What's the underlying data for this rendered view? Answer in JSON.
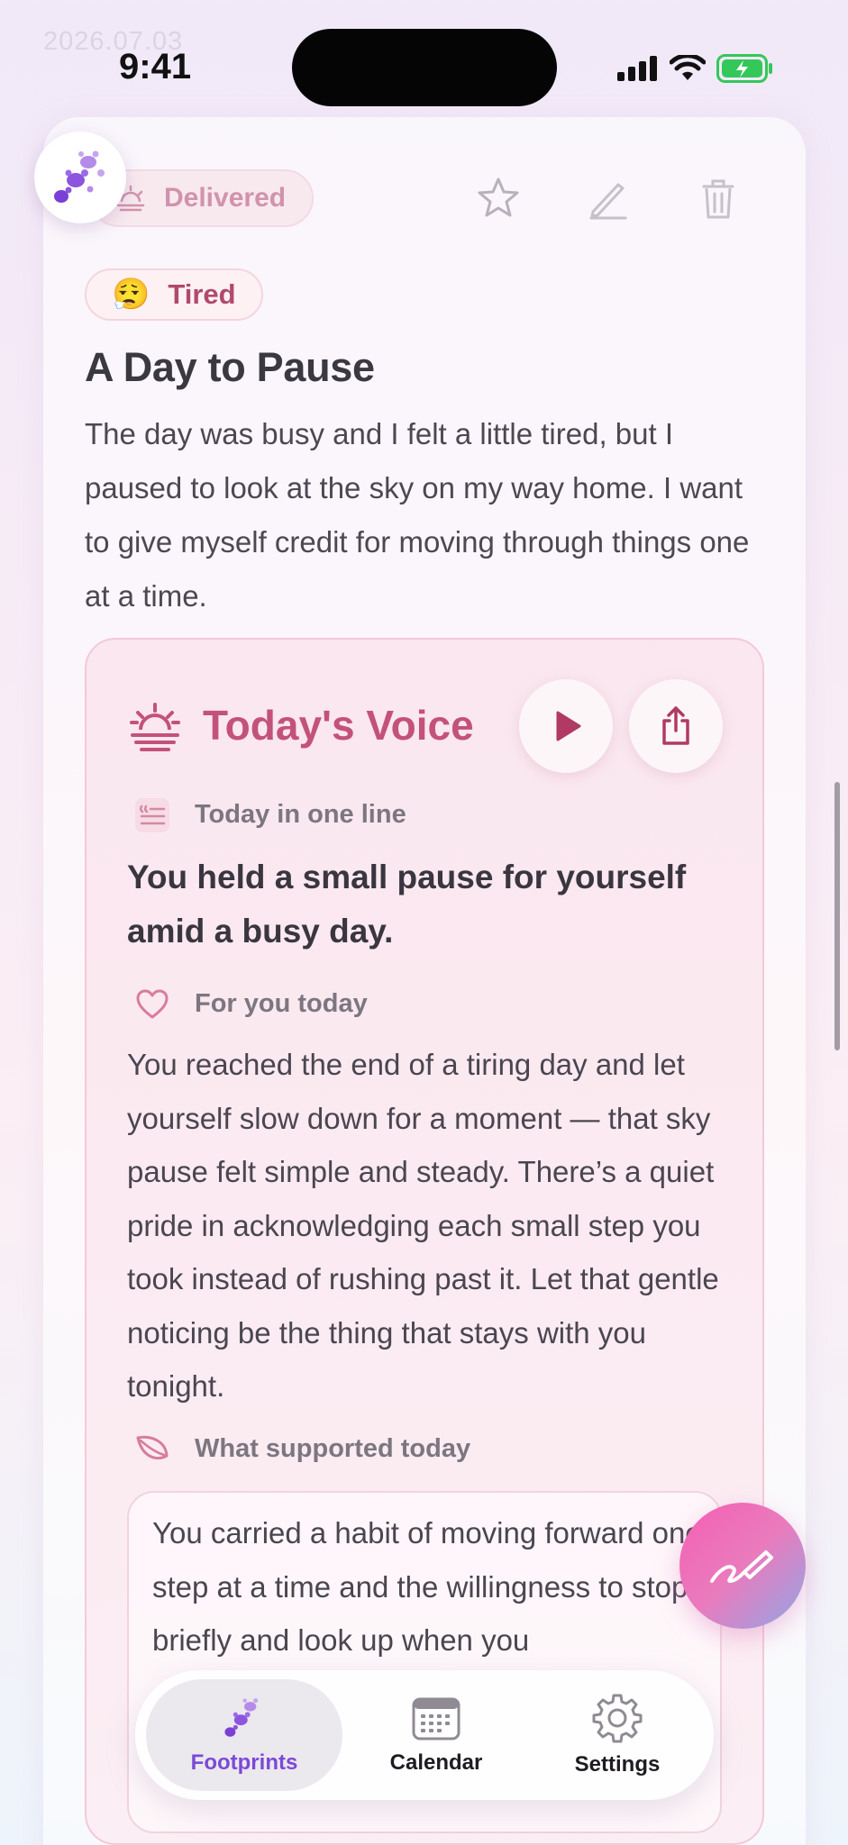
{
  "status_bar": {
    "ghost_date": "2026.07.03",
    "time": "9:41"
  },
  "entry": {
    "status_badge": "Delivered",
    "mood": {
      "emoji": "😮‍💨",
      "label": "Tired"
    },
    "title": "A Day to Pause",
    "body": "The day was busy and I felt a little tired, but I paused to look at the sky on my way home. I want to give myself credit for moving through things one at a time."
  },
  "voice": {
    "title": "Today's Voice",
    "oneline_label": "Today in one line",
    "oneline_text": "You held a small pause for yourself amid a busy day.",
    "foryou_label": "For you today",
    "foryou_text": "You reached the end of a tiring day and let yourself slow down for a moment — that sky pause felt simple and steady. There’s a quiet pride in acknowledging each small step you took instead of rushing past it. Let that gentle noticing be the thing that stays with you tonight.",
    "support_label": "What supported today",
    "support_text": "You carried a habit of moving forward one step at a time and the willingness to stop briefly and look up when you"
  },
  "tabs": [
    {
      "label": "Footprints",
      "icon": "footprints-icon",
      "active": true
    },
    {
      "label": "Calendar",
      "icon": "calendar-icon",
      "active": false
    },
    {
      "label": "Settings",
      "icon": "gear-icon",
      "active": false
    }
  ],
  "colors": {
    "accent_pink": "#c3527a",
    "accent_purple": "#7c49d6",
    "mood_text": "#b04a6d"
  }
}
